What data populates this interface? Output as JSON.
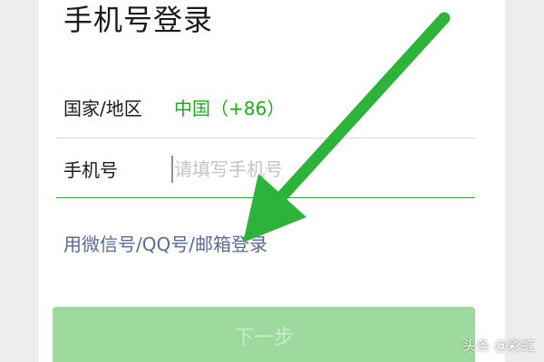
{
  "header": {
    "title": "手机号登录"
  },
  "form": {
    "country_label": "国家/地区",
    "country_value": "中国（+86）",
    "phone_label": "手机号",
    "phone_placeholder": "请填写手机号",
    "phone_value": ""
  },
  "alt_login": {
    "label": "用微信号/QQ号/邮箱登录"
  },
  "actions": {
    "next_label": "下一步"
  },
  "watermark": {
    "text": "头条 @彩虹"
  },
  "annotation": {
    "arrow_color": "#2db33a",
    "icon": "arrow-icon"
  },
  "colors": {
    "accent_green": "#1aad19",
    "link_blue": "#576b95",
    "button_disabled": "#9ed99d"
  }
}
